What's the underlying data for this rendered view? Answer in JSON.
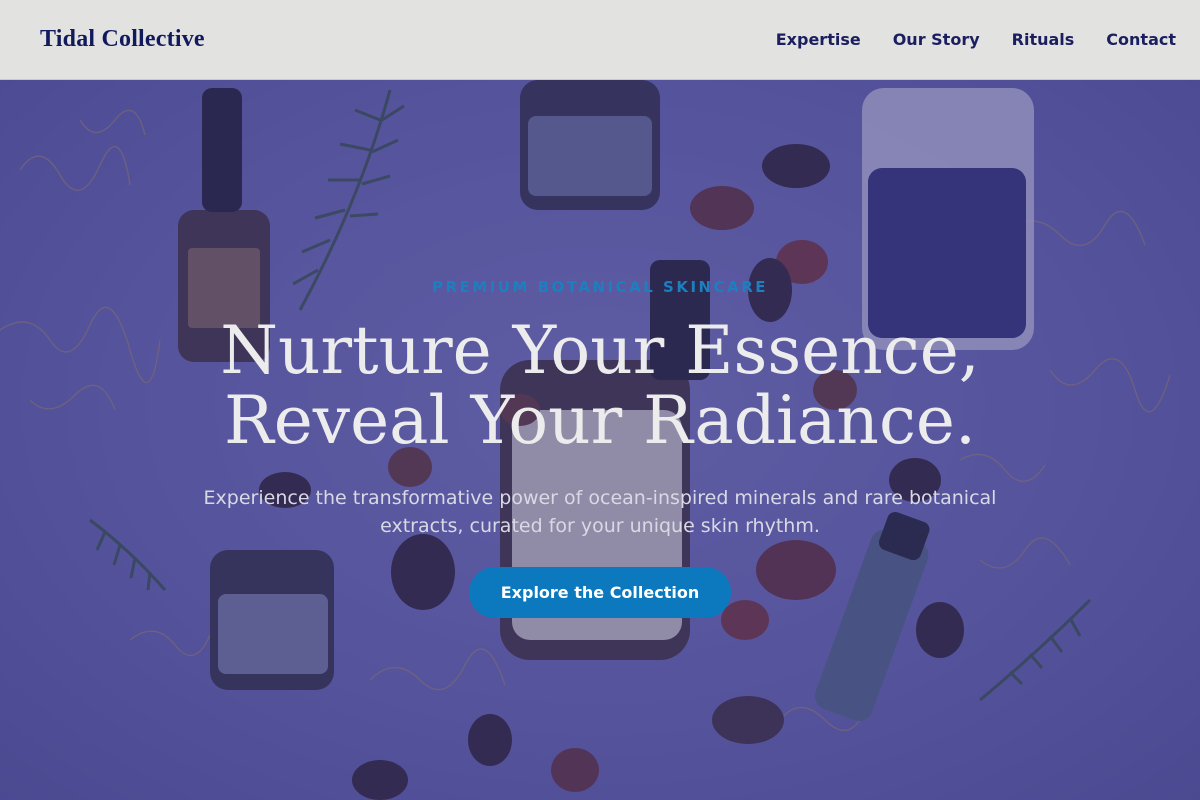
{
  "header": {
    "brand": "Tidal Collective",
    "nav": [
      {
        "label": "Expertise"
      },
      {
        "label": "Our Story"
      },
      {
        "label": "Rituals"
      },
      {
        "label": "Contact"
      }
    ]
  },
  "hero": {
    "eyebrow": "PREMIUM BOTANICAL SKINCARE",
    "headline_line1": "Nurture Your Essence,",
    "headline_line2": "Reveal Your Radiance.",
    "subtext": "Experience the transformative power of ocean-inspired minerals and rare botanical extracts, curated for your unique skin rhythm.",
    "cta_label": "Explore the Collection"
  },
  "colors": {
    "header_bg": "#e2e3e0",
    "brand_text": "#121a5e",
    "hero_overlay": "#5b5a9c",
    "accent": "#0c78bd",
    "eyebrow": "#1b7fc0"
  }
}
